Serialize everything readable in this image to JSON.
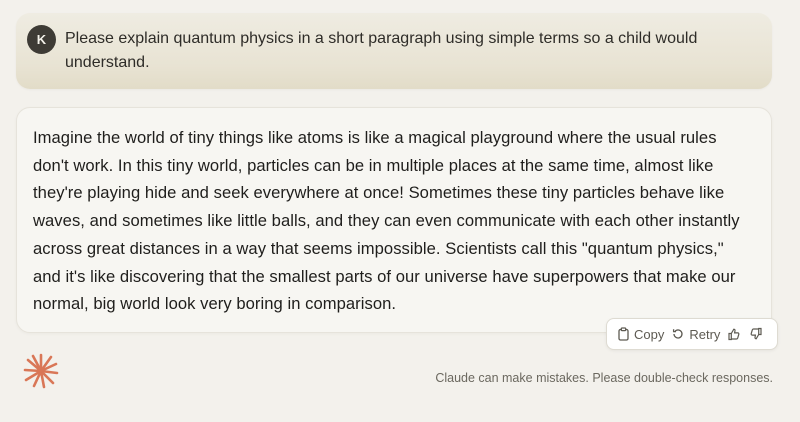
{
  "user": {
    "avatar_initial": "K",
    "message": "Please explain quantum physics in a short paragraph using simple terms so a child would understand."
  },
  "assistant": {
    "response": "Imagine the world of tiny things like atoms is like a magical playground where the usual rules don't work. In this tiny world, particles can be in multiple places at the same time, almost like they're playing hide and seek everywhere at once! Sometimes these tiny particles behave like waves, and sometimes like little balls, and they can even communicate with each other instantly across great distances in a way that seems impossible. Scientists call this \"quantum physics,\" and it's like discovering that the smallest parts of our universe have superpowers that make our normal, big world look very boring in comparison."
  },
  "actions": {
    "copy_label": "Copy",
    "retry_label": "Retry",
    "icons": [
      "clipboard-icon",
      "retry-icon",
      "thumbs-up-icon",
      "thumbs-down-icon"
    ]
  },
  "footer": {
    "disclaimer": "Claude can make mistakes. Please double-check responses.",
    "logo_icon": "claude-starburst-icon"
  },
  "colors": {
    "page_bg": "#f3f1ec",
    "user_bubble": "#e8e3d3",
    "avatar_bg": "#3e3b35",
    "accent": "#d97757"
  }
}
